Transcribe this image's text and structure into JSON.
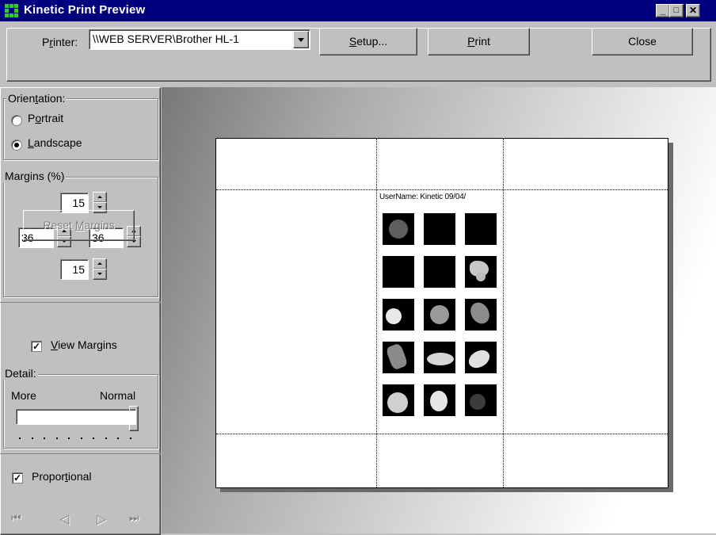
{
  "window": {
    "title": "Kinetic Print Preview",
    "controls": {
      "minimize": "_",
      "maximize": "□",
      "close": "✕"
    }
  },
  "toolbar": {
    "printer_label_pre": "P",
    "printer_label_u": "r",
    "printer_label_post": "inter:",
    "printer_value": "\\\\WEB SERVER\\Brother HL-1",
    "setup_u": "S",
    "setup_rest": "etup...",
    "print_u": "P",
    "print_rest": "rint",
    "close_label": "Close"
  },
  "orientation": {
    "label_pre": "Orien",
    "label_u": "t",
    "label_post": "ation:",
    "portrait_pre": "P",
    "portrait_u": "o",
    "portrait_post": "rtrait",
    "landscape_u": "L",
    "landscape_rest": "andscape",
    "selected": "Landscape"
  },
  "margins": {
    "label": "Margins (%)",
    "top": "15",
    "left": "36",
    "right": "36",
    "bottom": "15",
    "reset_pre": "Reset ",
    "reset_u": "M",
    "reset_post": "argins",
    "view_u": "V",
    "view_rest": "iew Margins",
    "view_checked": true
  },
  "detail": {
    "label": "Detail:",
    "more": "More",
    "normal": "Normal",
    "level": 1.0
  },
  "proportional": {
    "pre": "Propor",
    "u": "t",
    "post": "ional",
    "checked": true
  },
  "navigation": {
    "first": "⏮",
    "prev": "◁",
    "next": "▷",
    "last": "⏭"
  },
  "document": {
    "header": "UserName: Kinetic   09/04/"
  },
  "colors": {
    "title_bar": "#00007f",
    "face": "#c0c0c0",
    "app_icon": "#3ac43a"
  },
  "icons": [
    "app-icon",
    "minimize-icon",
    "maximize-icon",
    "close-icon",
    "dropdown-arrow-icon",
    "spin-up-icon",
    "spin-down-icon",
    "first-page-icon",
    "prev-page-icon",
    "next-page-icon",
    "last-page-icon"
  ]
}
